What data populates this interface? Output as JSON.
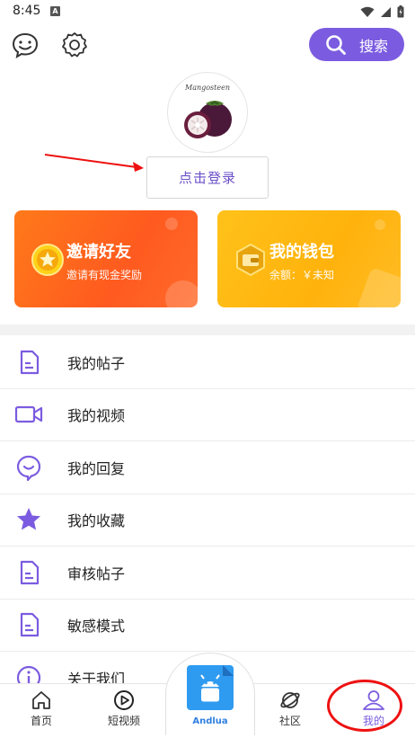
{
  "status_bar": {
    "time": "8:45",
    "notification_badge": "A"
  },
  "toolbar": {
    "search_label": "搜索"
  },
  "profile": {
    "avatar_text": "Mangosteen",
    "login_label": "点击登录"
  },
  "cards": {
    "invite": {
      "title": "邀请好友",
      "subtitle": "邀请有现金奖励"
    },
    "wallet": {
      "title": "我的钱包",
      "subtitle": "余额：￥未知"
    }
  },
  "menu": [
    {
      "label": "我的帖子",
      "icon": "document-icon"
    },
    {
      "label": "我的视频",
      "icon": "video-icon"
    },
    {
      "label": "我的回复",
      "icon": "reply-icon"
    },
    {
      "label": "我的收藏",
      "icon": "star-icon"
    },
    {
      "label": "审核帖子",
      "icon": "document-icon"
    },
    {
      "label": "敏感模式",
      "icon": "document-icon"
    },
    {
      "label": "关于我们",
      "icon": "info-icon"
    }
  ],
  "bottom_nav": {
    "home": "首页",
    "short_video": "短视频",
    "center": "Andlua",
    "community": "社区",
    "mine": "我的"
  },
  "colors": {
    "accent": "#7b5ce0",
    "invite_card": "#ff6a1f",
    "wallet_card": "#ffb80f",
    "annotation": "#e11111"
  }
}
